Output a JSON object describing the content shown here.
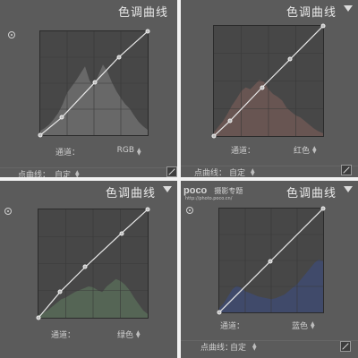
{
  "panels": [
    {
      "title": "色调曲线",
      "channel_label": "通道：",
      "channel_value": "RGB",
      "points_label": "点曲线：",
      "points_value": "自定",
      "curve_color": "#e8e8e8",
      "hist_color": "#6c6c6c",
      "curve_points": [
        [
          0,
          0
        ],
        [
          20,
          17
        ],
        [
          51,
          51
        ],
        [
          73,
          75
        ],
        [
          100,
          100
        ]
      ]
    },
    {
      "title": "色调曲线",
      "channel_label": "通道：",
      "channel_value": "红色",
      "points_label": "点曲线：",
      "points_value": "自定",
      "curve_color": "#e8e8e8",
      "hist_color": "#6b5753",
      "curve_points": [
        [
          0,
          0
        ],
        [
          15,
          14
        ],
        [
          44,
          44
        ],
        [
          70,
          70
        ],
        [
          100,
          100
        ]
      ]
    },
    {
      "title": "色调曲线",
      "channel_label": "通道：",
      "channel_value": "绿色",
      "points_label": "点曲线：",
      "points_value": "",
      "curve_color": "#e8e8e8",
      "hist_color": "#566857",
      "curve_points": [
        [
          0,
          0
        ],
        [
          20,
          24
        ],
        [
          43,
          47
        ],
        [
          76,
          78
        ],
        [
          100,
          100
        ]
      ]
    },
    {
      "title": "色调曲线",
      "channel_label": "通道：",
      "channel_value": "蓝色",
      "points_label": "点曲线：",
      "points_value": "自定",
      "curve_color": "#e8e8e8",
      "hist_color": "#3f4a6e",
      "curve_points": [
        [
          0,
          0
        ],
        [
          49,
          49
        ],
        [
          100,
          100
        ]
      ]
    }
  ],
  "watermark": {
    "logo": "poco",
    "subtitle": "摄影专题",
    "url": "http://photo.poco.cn/"
  }
}
